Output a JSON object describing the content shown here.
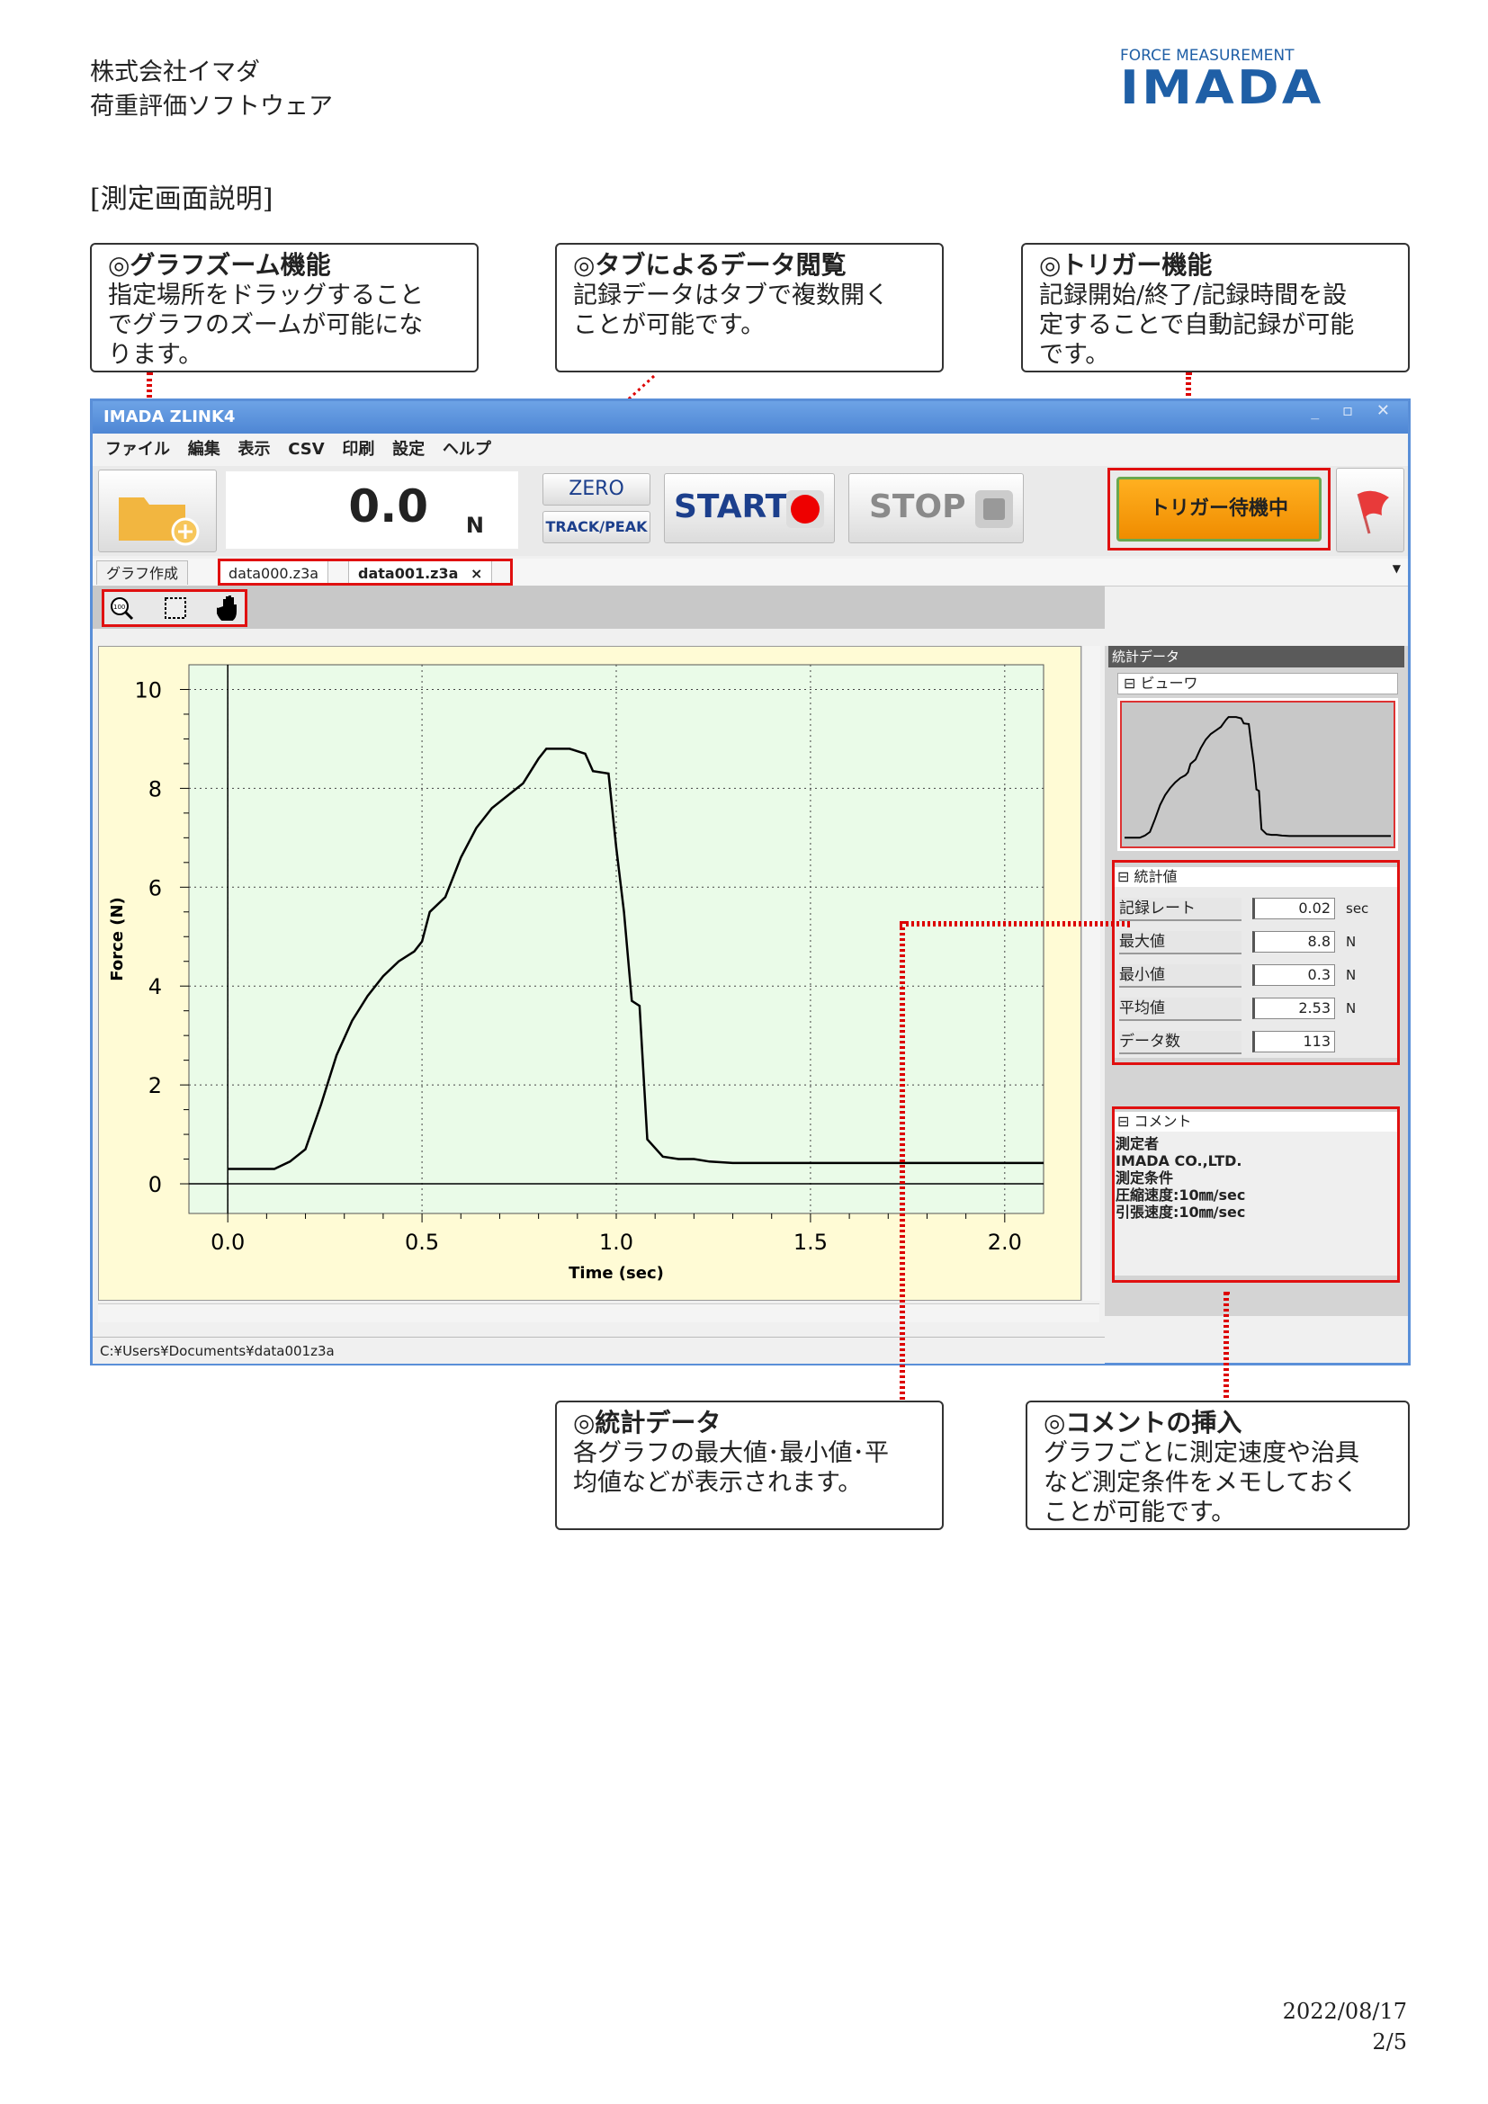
{
  "header": {
    "company": "株式会社イマダ",
    "product": "荷重評価ソフトウェア",
    "logo_top": "FORCE MEASUREMENT",
    "logo_main": "IMADA",
    "section_title": "[測定画面説明]"
  },
  "callouts": {
    "zoom": {
      "title": "◎グラフズーム機能",
      "body": [
        "指定場所をドラッグすること",
        "でグラフのズームが可能にな",
        "ります。"
      ]
    },
    "tabs": {
      "title": "◎タブによるデータ閲覧",
      "body": [
        "記録データはタブで複数開く",
        "ことが可能です。"
      ]
    },
    "trigger": {
      "title": "◎トリガー機能",
      "body": [
        "記録開始/終了/記録時間を設",
        "定することで自動記録が可能",
        "です。"
      ]
    },
    "stats": {
      "title": "◎統計データ",
      "body": [
        "各グラフの最大値･最小値･平",
        "均値などが表示されます。"
      ]
    },
    "comment": {
      "title": "◎コメントの挿入",
      "body": [
        "グラフごとに測定速度や治具",
        "など測定条件をメモしておく",
        "ことが可能です。"
      ]
    }
  },
  "app": {
    "title": "IMADA ZLINK4",
    "menu": [
      "ファイル",
      "編集",
      "表示",
      "CSV",
      "印刷",
      "設定",
      "ヘルプ"
    ],
    "reading_value": "0.0",
    "reading_unit": "N",
    "zero_label": "ZERO",
    "trackpeak_label": "TRACK/PEAK",
    "start_label": "START",
    "stop_label": "STOP",
    "trigger_label": "トリガー待機中",
    "tabs": [
      "グラフ作成",
      "data000.z3a",
      "data001.z3a"
    ],
    "tab_close": "×",
    "status_path": "C:¥Users¥Documents¥data001z3a",
    "side": {
      "panel_title": "統計データ",
      "viewer_label": "ビューワ",
      "stats_label": "統計値",
      "stats": [
        {
          "label": "記録レート",
          "value": "0.02",
          "unit": "sec"
        },
        {
          "label": "最大値",
          "value": "8.8",
          "unit": "N"
        },
        {
          "label": "最小値",
          "value": "0.3",
          "unit": "N"
        },
        {
          "label": "平均値",
          "value": "2.53",
          "unit": "N"
        },
        {
          "label": "データ数",
          "value": "113",
          "unit": ""
        }
      ],
      "comment_label": "コメント",
      "comment_lines": [
        "測定者",
        "IMADA CO.,LTD.",
        "測定条件",
        "圧縮速度:10㎜/sec",
        "引張速度:10㎜/sec"
      ]
    }
  },
  "chart_data": {
    "type": "line",
    "xlabel": "Time (sec)",
    "ylabel": "Force (N)",
    "xlim": [
      -0.1,
      2.1
    ],
    "ylim": [
      -0.6,
      10.5
    ],
    "xticks": [
      "0.0",
      "0.5",
      "1.0",
      "1.5",
      "2.0"
    ],
    "yticks": [
      "0",
      "2",
      "4",
      "6",
      "8",
      "10"
    ],
    "grid": true,
    "series": [
      {
        "x": [
          0.0,
          0.04,
          0.08,
          0.12,
          0.16,
          0.2,
          0.24,
          0.28,
          0.32,
          0.36,
          0.4,
          0.44,
          0.48,
          0.5,
          0.52,
          0.56,
          0.6,
          0.64,
          0.68,
          0.72,
          0.76,
          0.8,
          0.82,
          0.84,
          0.88,
          0.92,
          0.94,
          0.98,
          1.0,
          1.02,
          1.04,
          1.06,
          1.08,
          1.12,
          1.16,
          1.2,
          1.24,
          1.3,
          1.5,
          1.8,
          2.1
        ],
        "y": [
          0.3,
          0.3,
          0.3,
          0.3,
          0.45,
          0.7,
          1.6,
          2.6,
          3.3,
          3.8,
          4.2,
          4.5,
          4.7,
          4.9,
          5.5,
          5.8,
          6.6,
          7.2,
          7.6,
          7.85,
          8.1,
          8.6,
          8.8,
          8.8,
          8.8,
          8.7,
          8.35,
          8.3,
          6.8,
          5.5,
          3.7,
          3.6,
          0.9,
          0.55,
          0.5,
          0.5,
          0.45,
          0.42,
          0.42,
          0.42,
          0.42
        ]
      }
    ]
  },
  "footer": {
    "date": "2022/08/17",
    "page": "2/5"
  }
}
